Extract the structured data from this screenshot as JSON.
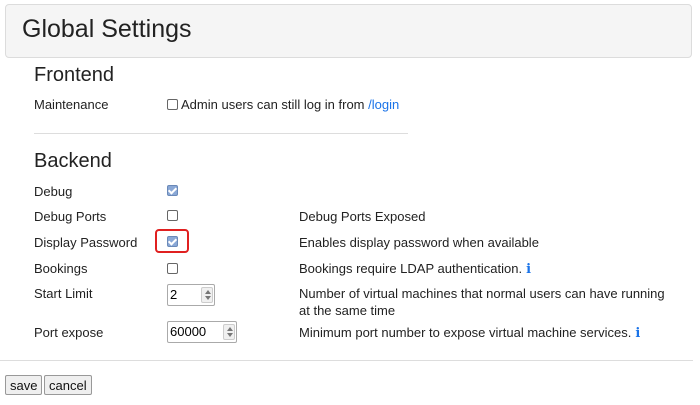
{
  "page_title": "Global Settings",
  "frontend": {
    "heading": "Frontend",
    "maintenance": {
      "label": "Maintenance",
      "checkbox_text": "Admin users can still log in from ",
      "link_text": "/login",
      "checked": false
    }
  },
  "backend": {
    "heading": "Backend",
    "debug": {
      "label": "Debug",
      "checked": true
    },
    "debug_ports": {
      "label": "Debug Ports",
      "checked": false,
      "description": "Debug Ports Exposed"
    },
    "display_password": {
      "label": "Display Password",
      "checked": true,
      "description": "Enables display password when available"
    },
    "bookings": {
      "label": "Bookings",
      "checked": false,
      "description": "Bookings require LDAP authentication.",
      "info_icon": "info-icon"
    },
    "start_limit": {
      "label": "Start Limit",
      "value": "2",
      "description": "Number of virtual machines that normal users can have running at the same time"
    },
    "port_expose": {
      "label": "Port expose",
      "value": "60000",
      "description": "Minimum port number to expose virtual machine services.",
      "info_icon": "info-icon"
    }
  },
  "buttons": {
    "save": "save",
    "cancel": "cancel"
  },
  "colors": {
    "link": "#1a73e8",
    "highlight": "#e02020",
    "checkbox_checked": "#8aa8d6"
  }
}
